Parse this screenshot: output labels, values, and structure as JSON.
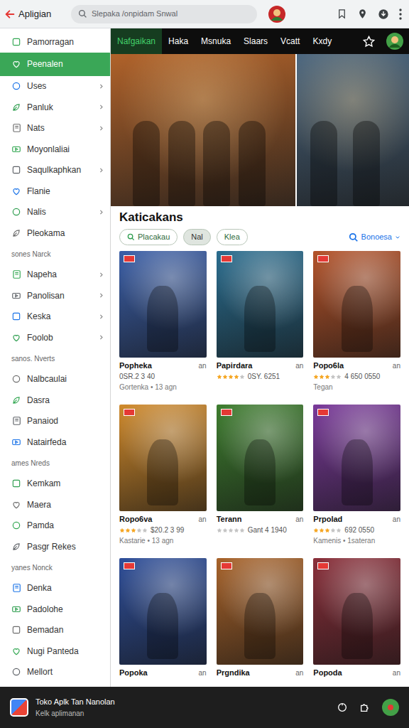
{
  "app_bar": {
    "title": "Apligian",
    "search": {
      "placeholder": "Slepaka /onpidam Snwal"
    }
  },
  "sidebar": {
    "groups": [
      {
        "items": [
          {
            "label": "Pamorragan",
            "selected": false,
            "expandable": false
          },
          {
            "label": "Peenalen",
            "selected": true,
            "expandable": false
          },
          {
            "label": "Uses",
            "selected": false,
            "expandable": true
          },
          {
            "label": "Panluk",
            "selected": false,
            "expandable": true
          },
          {
            "label": "Nats",
            "selected": false,
            "expandable": true
          },
          {
            "label": "Moyonlaliai",
            "selected": false,
            "expandable": false
          },
          {
            "label": "Saqulkaphkan",
            "selected": false,
            "expandable": true
          },
          {
            "label": "Flanie",
            "selected": false,
            "expandable": false
          },
          {
            "label": "Nalis",
            "selected": false,
            "expandable": true
          },
          {
            "label": "Pleokama",
            "selected": false,
            "expandable": false
          }
        ]
      },
      {
        "title": "sones Narck",
        "items": [
          {
            "label": "Napeha",
            "selected": false,
            "expandable": true
          },
          {
            "label": "Panolisan",
            "selected": false,
            "expandable": true
          },
          {
            "label": "Keska",
            "selected": false,
            "expandable": true
          },
          {
            "label": "Foolob",
            "selected": false,
            "expandable": true
          }
        ]
      },
      {
        "title": "sanos. Nverts",
        "items": [
          {
            "label": "Nalbcaulai",
            "selected": false,
            "expandable": false
          },
          {
            "label": "Dasra",
            "selected": false,
            "expandable": false
          },
          {
            "label": "Panaiod",
            "selected": false,
            "expandable": false
          },
          {
            "label": "Natairfeda",
            "selected": false,
            "expandable": false
          }
        ]
      },
      {
        "title": "ames Nreds",
        "items": [
          {
            "label": "Kemkam",
            "selected": false,
            "expandable": false
          },
          {
            "label": "Maera",
            "selected": false,
            "expandable": false
          },
          {
            "label": "Pamda",
            "selected": false,
            "expandable": false
          },
          {
            "label": "Pasgr Rekes",
            "selected": false,
            "expandable": false
          }
        ]
      },
      {
        "title": "yanes Nonck",
        "items": [
          {
            "label": "Denka",
            "selected": false,
            "expandable": false
          },
          {
            "label": "Padolohe",
            "selected": false,
            "expandable": false
          },
          {
            "label": "Bemadan",
            "selected": false,
            "expandable": false
          },
          {
            "label": "Nugi Panteda",
            "selected": false,
            "expandable": false
          },
          {
            "label": "Mellort",
            "selected": false,
            "expandable": false
          }
        ]
      }
    ]
  },
  "tabs": [
    {
      "label": "Nafgaikan",
      "selected": true
    },
    {
      "label": "Haka",
      "selected": false
    },
    {
      "label": "Msnuka",
      "selected": false
    },
    {
      "label": "Slaars",
      "selected": false
    },
    {
      "label": "Vcatt",
      "selected": false
    },
    {
      "label": "Kxdy",
      "selected": false
    }
  ],
  "banners": [
    {
      "color": "#b0622a"
    },
    {
      "color": "#4a6680"
    }
  ],
  "section": {
    "title": "Katicakans",
    "filters": [
      {
        "label": "Placakau",
        "selected": false,
        "kind": "search"
      },
      {
        "label": "Nal",
        "selected": true,
        "kind": "plain"
      },
      {
        "label": "Klea",
        "selected": false,
        "kind": "plain"
      }
    ],
    "sort": {
      "label": "Bonoesa"
    }
  },
  "apps": [
    {
      "title": "Popheka",
      "tag": "an",
      "meta": "0SR.2 3 40",
      "sub": "Gortenka • 13 agn",
      "color": "#3b5fa8"
    },
    {
      "title": "Papirdara",
      "tag": "an",
      "stars": 4,
      "meta": "0SY. 6251",
      "color": "#2a6d8f"
    },
    {
      "title": "Popo6la",
      "tag": "an",
      "stars": 3,
      "meta": "4 650 0550",
      "sub": "Tegan",
      "color": "#b4532a"
    },
    {
      "title": "Ropo6va",
      "tag": "an",
      "stars": 3,
      "meta": "$20.2 3 99",
      "sub": "Kastarie • 13 agn",
      "color": "#d08a2c"
    },
    {
      "title": "Terann",
      "tag": "an",
      "stars": 0,
      "meta": "Gant 4 1940",
      "color": "#3e7d2f"
    },
    {
      "title": "Prpolad",
      "tag": "an",
      "stars": 3,
      "meta": "692 0550",
      "sub": "Kamenis • 1sateran",
      "color": "#7a3a9a"
    },
    {
      "title": "Popoka",
      "tag": "an",
      "color": "#2f4f9a"
    },
    {
      "title": "Prgndika",
      "tag": "an",
      "color": "#a8632a"
    },
    {
      "title": "Popoda",
      "tag": "an",
      "color": "#8a2f3a"
    }
  ],
  "bottom_bar": {
    "title": "Toko Aplk Tan Nanolan",
    "subtitle": "Kelk aplimanan"
  }
}
